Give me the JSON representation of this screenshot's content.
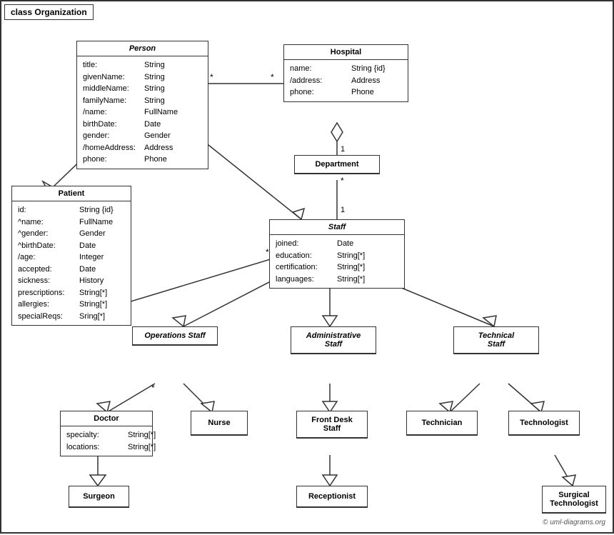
{
  "title": "class Organization",
  "copyright": "© uml-diagrams.org",
  "classes": {
    "person": {
      "name": "Person",
      "italic": true,
      "attrs": [
        {
          "name": "title:",
          "type": "String"
        },
        {
          "name": "givenName:",
          "type": "String"
        },
        {
          "name": "middleName:",
          "type": "String"
        },
        {
          "name": "familyName:",
          "type": "String"
        },
        {
          "name": "/name:",
          "type": "FullName"
        },
        {
          "name": "birthDate:",
          "type": "Date"
        },
        {
          "name": "gender:",
          "type": "Gender"
        },
        {
          "name": "/homeAddress:",
          "type": "Address"
        },
        {
          "name": "phone:",
          "type": "Phone"
        }
      ]
    },
    "hospital": {
      "name": "Hospital",
      "italic": false,
      "attrs": [
        {
          "name": "name:",
          "type": "String {id}"
        },
        {
          "name": "/address:",
          "type": "Address"
        },
        {
          "name": "phone:",
          "type": "Phone"
        }
      ]
    },
    "department": {
      "name": "Department",
      "italic": false,
      "attrs": []
    },
    "staff": {
      "name": "Staff",
      "italic": true,
      "attrs": [
        {
          "name": "joined:",
          "type": "Date"
        },
        {
          "name": "education:",
          "type": "String[*]"
        },
        {
          "name": "certification:",
          "type": "String[*]"
        },
        {
          "name": "languages:",
          "type": "String[*]"
        }
      ]
    },
    "patient": {
      "name": "Patient",
      "italic": false,
      "attrs": [
        {
          "name": "id:",
          "type": "String {id}"
        },
        {
          "name": "^name:",
          "type": "FullName"
        },
        {
          "name": "^gender:",
          "type": "Gender"
        },
        {
          "name": "^birthDate:",
          "type": "Date"
        },
        {
          "name": "/age:",
          "type": "Integer"
        },
        {
          "name": "accepted:",
          "type": "Date"
        },
        {
          "name": "sickness:",
          "type": "History"
        },
        {
          "name": "prescriptions:",
          "type": "String[*]"
        },
        {
          "name": "allergies:",
          "type": "String[*]"
        },
        {
          "name": "specialReqs:",
          "type": "Sring[*]"
        }
      ]
    },
    "operations_staff": {
      "name": "Operations Staff",
      "italic": true
    },
    "administrative_staff": {
      "name": "Administrative Staff",
      "italic": true
    },
    "technical_staff": {
      "name": "Technical Staff",
      "italic": true
    },
    "doctor": {
      "name": "Doctor",
      "italic": false,
      "attrs": [
        {
          "name": "specialty:",
          "type": "String[*]"
        },
        {
          "name": "locations:",
          "type": "String[*]"
        }
      ]
    },
    "nurse": {
      "name": "Nurse",
      "italic": false,
      "attrs": []
    },
    "front_desk_staff": {
      "name": "Front Desk Staff",
      "italic": false,
      "attrs": []
    },
    "technician": {
      "name": "Technician",
      "italic": false,
      "attrs": []
    },
    "technologist": {
      "name": "Technologist",
      "italic": false,
      "attrs": []
    },
    "surgeon": {
      "name": "Surgeon",
      "italic": false,
      "attrs": []
    },
    "receptionist": {
      "name": "Receptionist",
      "italic": false,
      "attrs": []
    },
    "surgical_technologist": {
      "name": "Surgical Technologist",
      "italic": false,
      "attrs": []
    }
  }
}
